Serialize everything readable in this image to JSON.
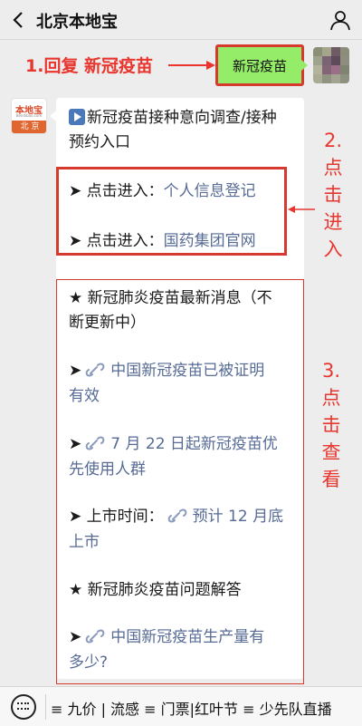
{
  "header": {
    "title": "北京本地宝"
  },
  "annotations": {
    "step1": "1.回复 新冠疫苗",
    "step2": [
      "2.",
      "点",
      "击",
      "进",
      "入"
    ],
    "step3": [
      "3.",
      "点",
      "击",
      "查",
      "看"
    ]
  },
  "outgoing": {
    "text": "新冠疫苗"
  },
  "incoming": {
    "avatar_logo": "本地宝",
    "avatar_sub": "Bendibao.com",
    "avatar_tag": "北 京",
    "intro_line1": "新冠疫苗接种意向调查/接种",
    "intro_line2": "预约入口",
    "entry1_prefix": "➤ 点击进入：",
    "entry1_link": "个人信息登记",
    "entry2_prefix": "➤ 点击进入：",
    "entry2_link": "国药集团官网",
    "news_head1": "★ 新冠肺炎疫苗最新消息（不",
    "news_head2": "断更新中）",
    "news1_arrow": "➤",
    "news1_line1": "中国新冠疫苗已被证明",
    "news1_line2": "有效",
    "news2_arrow": "➤",
    "news2_line1": "7 月 22 日起新冠疫苗优",
    "news2_line2": "先使用人群",
    "news3_prefix": "➤ 上市时间：",
    "news3_line1": "预计 12 月底",
    "news3_line2": "上市",
    "faq_head": "★ 新冠肺炎疫苗问题解答",
    "faq1_arrow": "➤",
    "faq1_line1": "中国新冠疫苗生产量有",
    "faq1_line2": "多少?"
  },
  "menu": {
    "items": "≡ 九价 | 流感 ≡ 门票|红叶节 ≡ 少先队直播"
  },
  "colors": {
    "annotation_red": "#e8362f",
    "link_blue": "#576b95",
    "bubble_green": "#95ec69",
    "background": "#ededed"
  }
}
